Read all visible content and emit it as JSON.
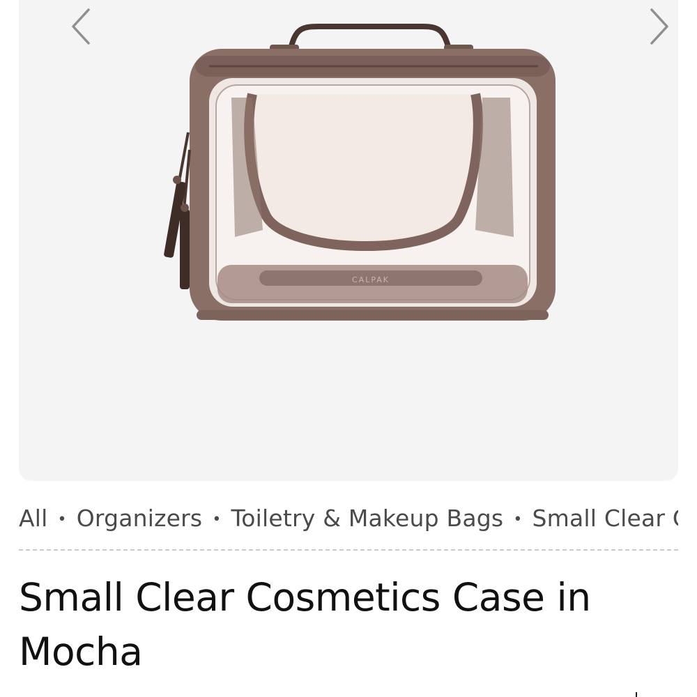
{
  "gallery": {
    "prev_icon": "chevron-left-icon",
    "next_icon": "chevron-right-icon",
    "background": "#f4f4f4",
    "brand_mark": "CALPAK"
  },
  "breadcrumb": {
    "items": [
      "All",
      "Organizers",
      "Toiletry & Makeup Bags",
      "Small Clear C"
    ],
    "separator": "•"
  },
  "product": {
    "title": "Small Clear Cosmetics Case in Mocha",
    "color_name": "Mocha",
    "trim_color": "#8a6f66"
  }
}
